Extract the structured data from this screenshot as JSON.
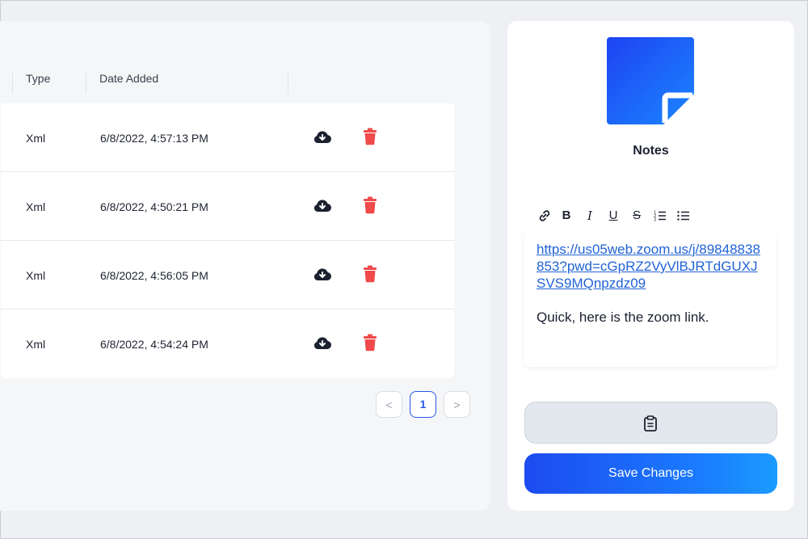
{
  "table": {
    "headers": {
      "type": "Type",
      "date_added": "Date Added"
    },
    "rows": [
      {
        "type": "Xml",
        "date_added": "6/8/2022, 4:57:13 PM"
      },
      {
        "type": "Xml",
        "date_added": "6/8/2022, 4:50:21 PM"
      },
      {
        "type": "Xml",
        "date_added": "6/8/2022, 4:56:05 PM"
      },
      {
        "type": "Xml",
        "date_added": "6/8/2022, 4:54:24 PM"
      }
    ],
    "row_icons": {
      "download": "cloud-download-icon",
      "delete": "trash-icon"
    }
  },
  "pagination": {
    "prev": "<",
    "current": "1",
    "next": ">"
  },
  "notes": {
    "title": "Notes",
    "toolbar": {
      "link": "link-icon",
      "bold": "B",
      "italic": "I",
      "underline": "U",
      "strike": "S",
      "ordered": "ordered-list-icon",
      "bullet": "bullet-list-icon"
    },
    "content_link": "https://us05web.zoom.us/j/89848838853?pwd=cGpRZ2VyVlBJRTdGUXJSVS9MQnpzdz09",
    "content_text": "Quick, here is the zoom link.",
    "clipboard_icon": "clipboard-icon",
    "save_label": "Save Changes"
  },
  "colors": {
    "accent": "#1d4bf0",
    "delete": "#f04a4a",
    "link": "#2163d6"
  }
}
